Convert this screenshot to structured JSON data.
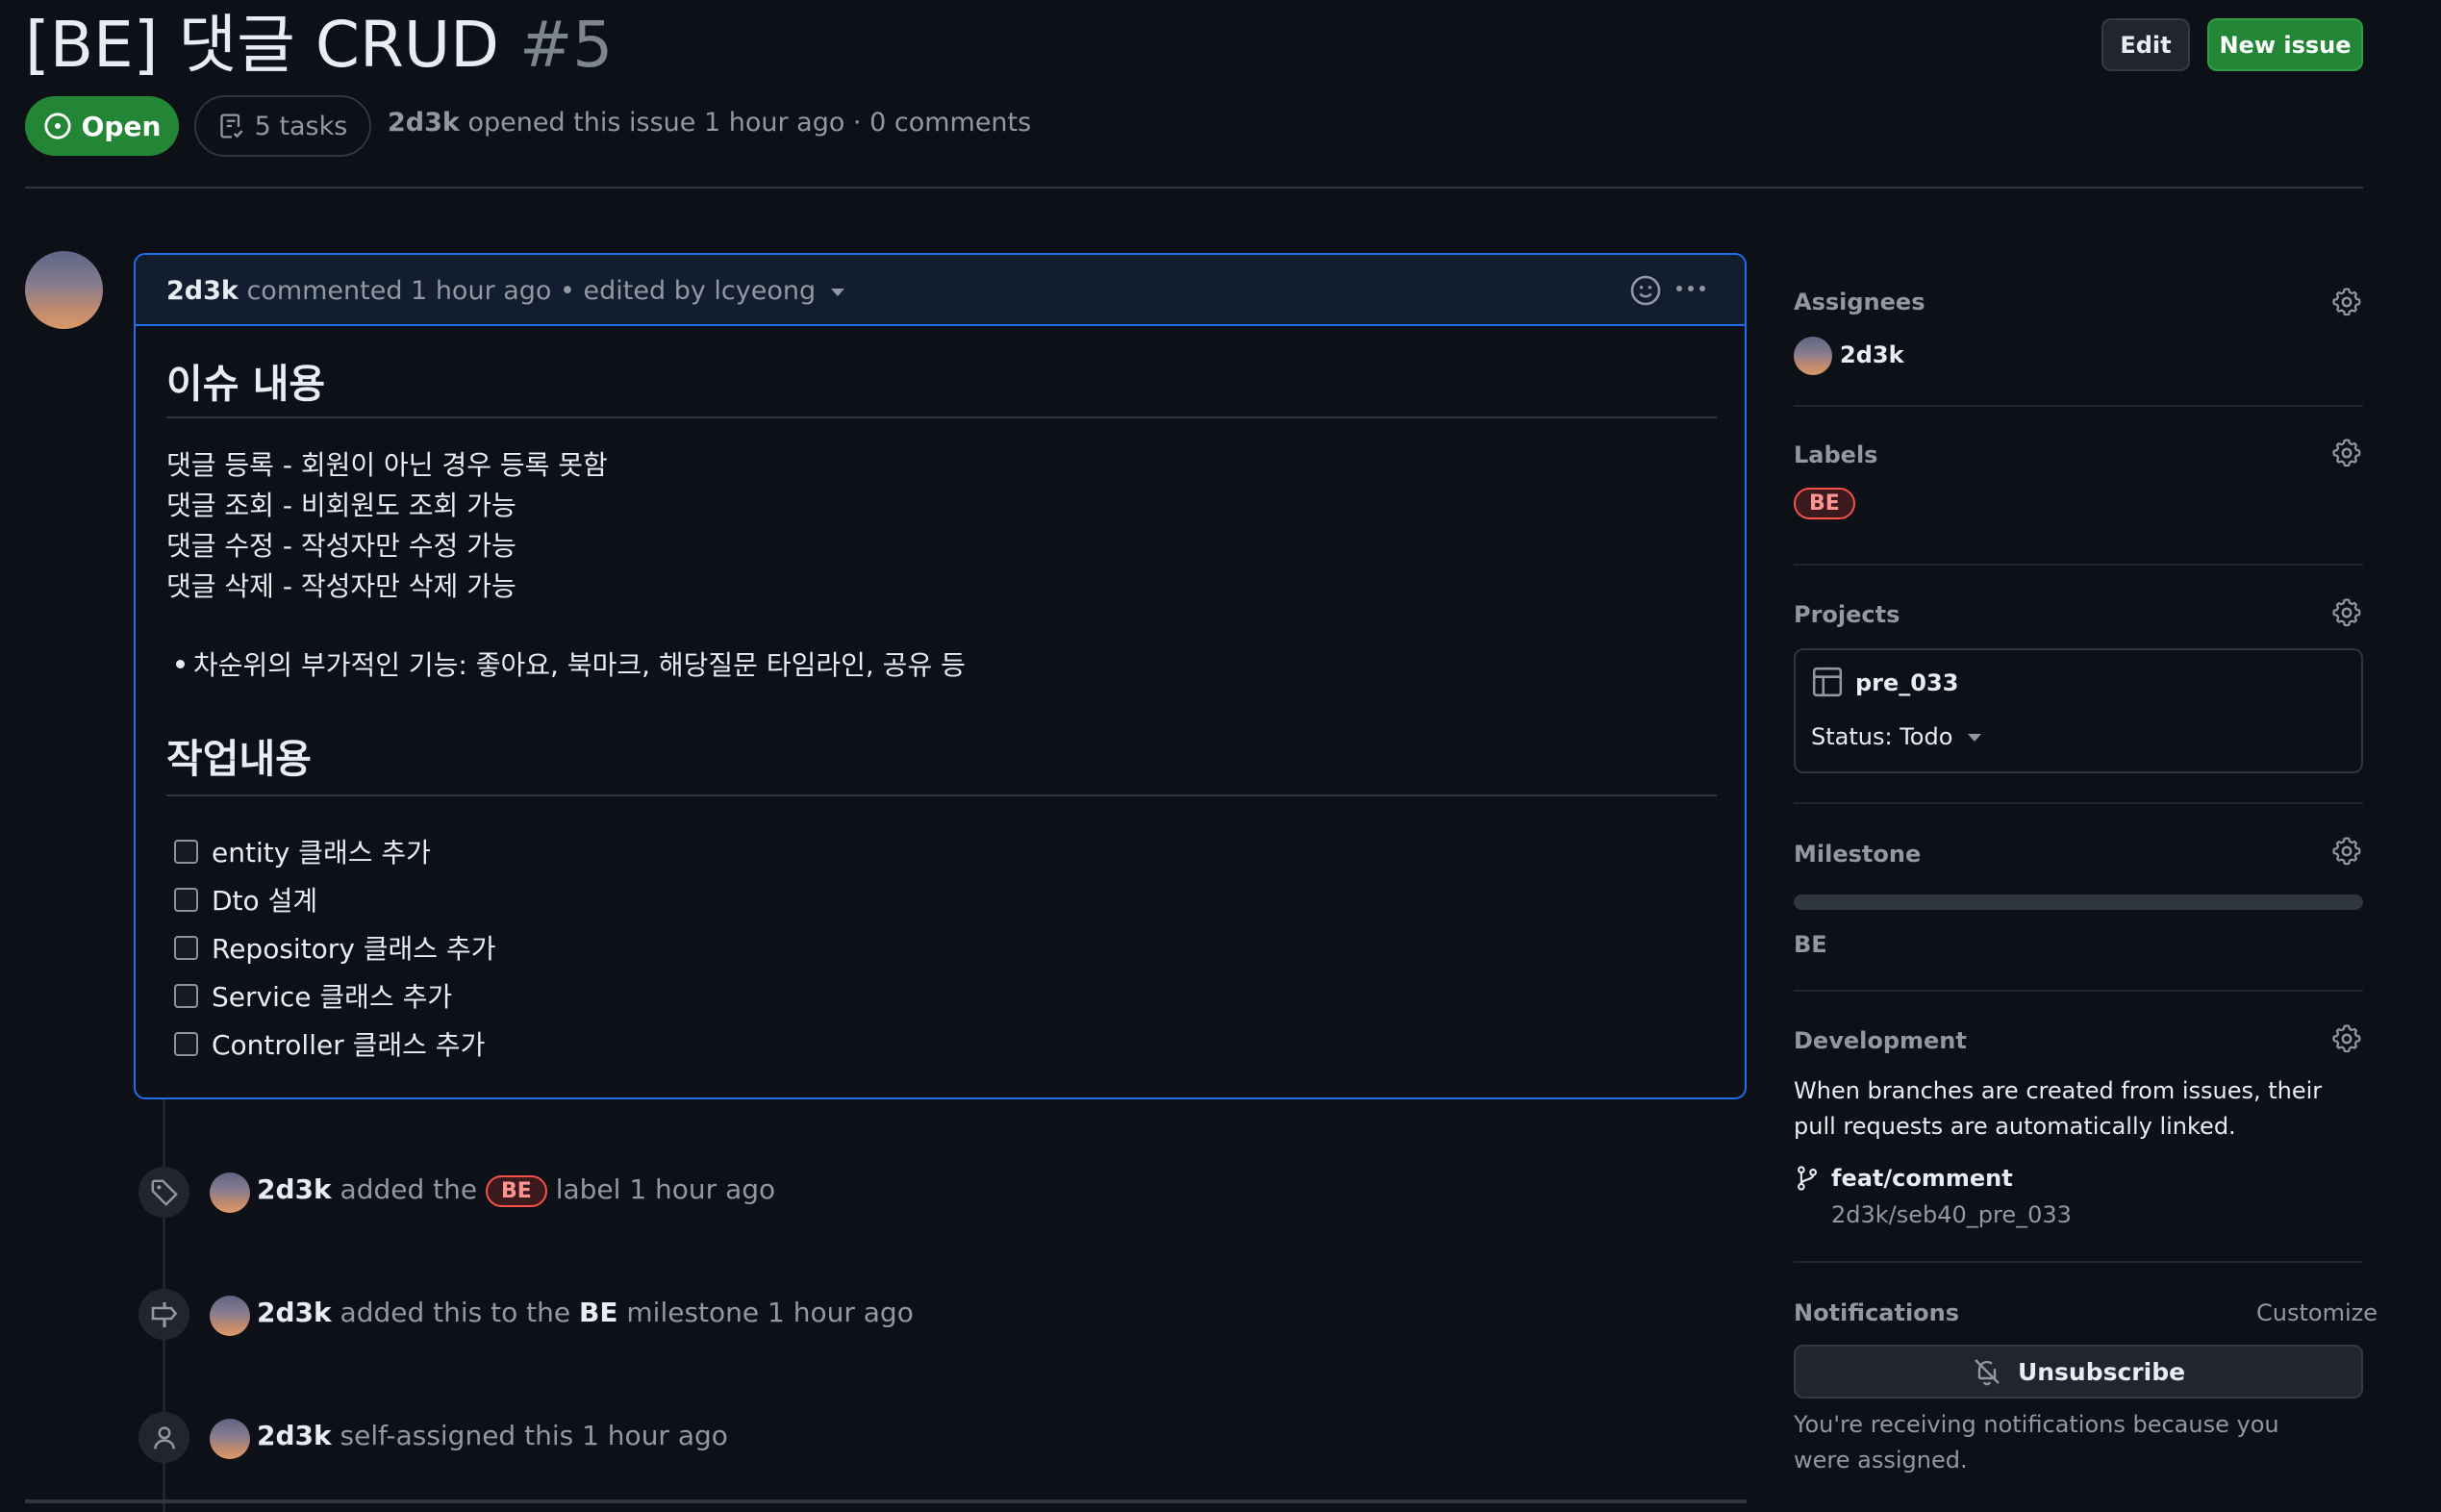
{
  "header": {
    "title": "[BE] 댓글 CRUD",
    "number": "#5",
    "edit_label": "Edit",
    "new_issue_label": "New issue",
    "state_label": "Open",
    "tasks_label": "5 tasks",
    "author": "2d3k",
    "meta_rest": "opened this issue 1 hour ago · 0 comments"
  },
  "comment": {
    "author": "2d3k",
    "meta": "commented 1 hour ago • edited by lcyeong",
    "heading1": "이슈 내용",
    "lines": [
      "댓글 등록 - 회원이 아닌 경우 등록 못함",
      "댓글 조회 - 비회원도 조회 가능",
      "댓글 수정 - 작성자만 수정 가능",
      "댓글 삭제 - 작성자만 삭제 가능"
    ],
    "bullet": "차순위의 부가적인 기능: 좋아요, 북마크, 해당질문 타임라인, 공유 등",
    "heading2": "작업내용",
    "tasks": [
      "entity 클래스 추가",
      "Dto 설계",
      "Repository 클래스 추가",
      "Service 클래스 추가",
      "Controller 클래스 추가"
    ]
  },
  "timeline": {
    "events": [
      {
        "icon": "tag-icon",
        "author": "2d3k",
        "before": "added the",
        "label": "BE",
        "after": "label 1 hour ago"
      },
      {
        "icon": "milestone-icon",
        "author": "2d3k",
        "before": "added this to the",
        "strong": "BE",
        "after": "milestone 1 hour ago"
      },
      {
        "icon": "person-icon",
        "author": "2d3k",
        "after": "self-assigned this 1 hour ago"
      }
    ]
  },
  "sidebar": {
    "assignees": {
      "title": "Assignees",
      "user": "2d3k"
    },
    "labels": {
      "title": "Labels",
      "label": "BE"
    },
    "projects": {
      "title": "Projects",
      "name": "pre_033",
      "status": "Status: Todo"
    },
    "milestone": {
      "title": "Milestone",
      "name": "BE",
      "progress": 0
    },
    "development": {
      "title": "Development",
      "description": "When branches are created from issues, their pull requests are automatically linked.",
      "branch": "feat/comment",
      "repo": "2d3k/seb40_pre_033"
    },
    "notifications": {
      "title": "Notifications",
      "customize": "Customize",
      "button": "Unsubscribe",
      "reason": "You're receiving notifications because you were assigned."
    }
  },
  "colors": {
    "background": "#0d1117",
    "open_green": "#238636",
    "accent_blue": "#1f6feb",
    "label_be": "#f85149"
  }
}
